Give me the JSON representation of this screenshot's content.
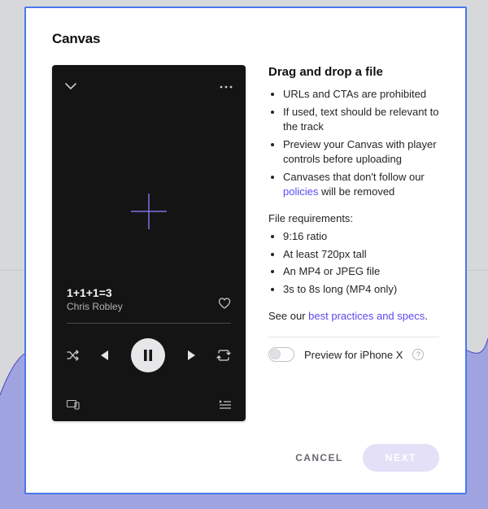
{
  "modal": {
    "title": "Canvas"
  },
  "preview": {
    "track_title": "1+1+1=3",
    "track_artist": "Chris Robley"
  },
  "right": {
    "heading": "Drag and drop a file",
    "guidelines": [
      "URLs and CTAs are prohibited",
      "If used, text should be relevant to the track",
      "Preview your Canvas with player controls before uploading",
      "Canvases that don't follow our "
    ],
    "policies_link": "policies",
    "guidelines_tail": " will be removed",
    "req_title": "File requirements:",
    "requirements": [
      "9:16 ratio",
      "At least 720px tall",
      "An MP4 or JPEG file",
      "3s to 8s long (MP4 only)"
    ],
    "see_prefix": "See our ",
    "see_link": "best practices and specs",
    "see_suffix": ".",
    "toggle_label": "Preview for iPhone X"
  },
  "footer": {
    "cancel": "CANCEL",
    "next": "NEXT"
  }
}
